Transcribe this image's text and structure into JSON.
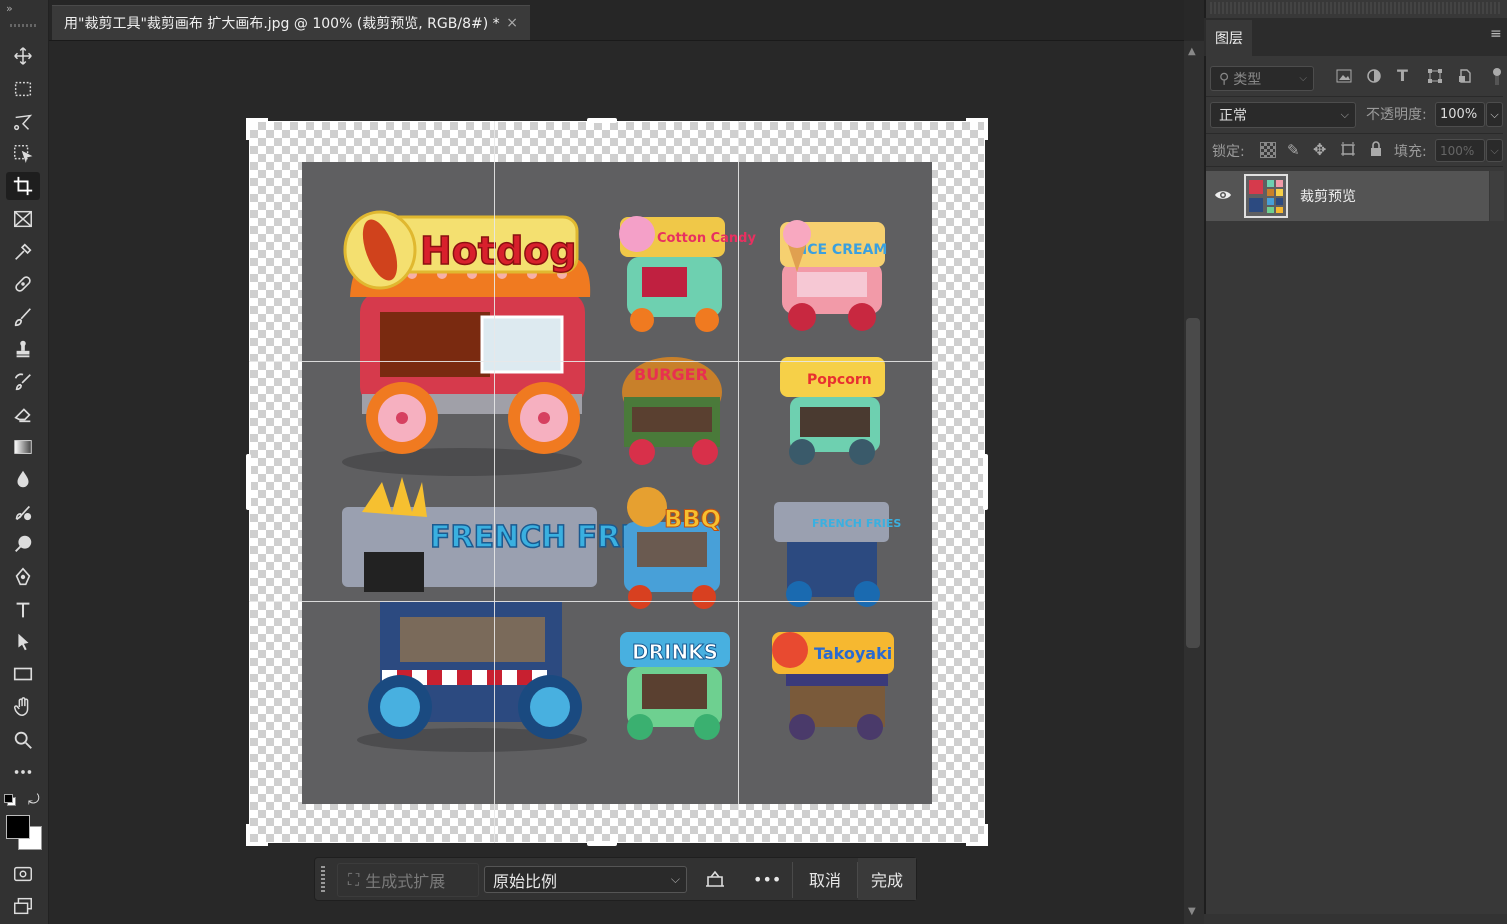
{
  "toolbar": {
    "collapse_label": "»",
    "tools": [
      "move-tool",
      "marquee-tool",
      "lasso-tool",
      "object-select-tool",
      "crop-tool",
      "frame-tool",
      "eyedropper-tool",
      "healing-tool",
      "brush-tool",
      "stamp-tool",
      "history-brush-tool",
      "eraser-tool",
      "gradient-tool",
      "blur-tool",
      "dodge-tool",
      "pen-tool",
      "type-tool",
      "path-select-tool",
      "rectangle-tool",
      "hand-tool",
      "zoom-tool",
      "more-tools"
    ],
    "active_tool": "crop-tool",
    "foreground_color": "#000000",
    "background_color": "#ffffff"
  },
  "document_tab": {
    "title": "用\"裁剪工具\"裁剪画布 扩大画布.jpg @ 100% (裁剪预览, RGB/8#) *",
    "close_label": "×"
  },
  "canvas": {
    "background_color": "#5f5f61",
    "carts": [
      "Hotdog",
      "Cotton Candy",
      "ICE CREAM",
      "BURGER",
      "Popcorn",
      "FRENCH FRIES",
      "BBQ",
      "FRENCH FRIES",
      "DRINKS",
      "Takoyaki"
    ]
  },
  "layers_panel": {
    "tab_label": "图层",
    "menu_label": "≡",
    "filter_placeholder": "类型",
    "blend_mode": "正常",
    "opacity_label": "不透明度:",
    "opacity_value": "100%",
    "lock_label": "锁定:",
    "fill_label": "填充:",
    "fill_value": "100%",
    "layers": [
      {
        "name": "裁剪预览",
        "visible": true
      }
    ]
  },
  "crop_options": {
    "generative_expand_label": "生成式扩展",
    "ratio_value": "原始比例",
    "more_label": "•••",
    "cancel_label": "取消",
    "done_label": "完成"
  }
}
